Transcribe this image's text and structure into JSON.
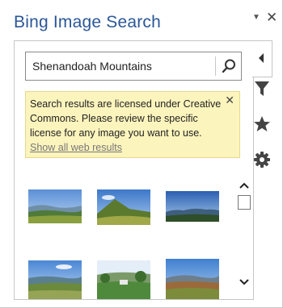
{
  "pane": {
    "title": "Bing Image Search",
    "menu_glyph": "▼",
    "close_glyph": "✕"
  },
  "search": {
    "value": "Shenandoah Mountains",
    "button_icon": "search-icon"
  },
  "notice": {
    "text": "Search results are licensed under Creative Commons. Please review the specific license for any image you want to use.",
    "link": "Show all web results",
    "close_glyph": "✕"
  },
  "side_tabs": [
    {
      "icon": "collapse-arrow-icon"
    },
    {
      "icon": "filter-icon"
    },
    {
      "icon": "star-icon"
    },
    {
      "icon": "gear-icon"
    }
  ],
  "results": [
    {
      "icon": "landscape-thumbnail"
    },
    {
      "icon": "landscape-thumbnail"
    },
    {
      "icon": "landscape-thumbnail"
    },
    {
      "icon": "landscape-thumbnail"
    },
    {
      "icon": "landscape-thumbnail"
    },
    {
      "icon": "landscape-thumbnail"
    }
  ],
  "colors": {
    "title": "#2b5797",
    "notice_bg": "#fcf4bd",
    "link": "#777777"
  }
}
